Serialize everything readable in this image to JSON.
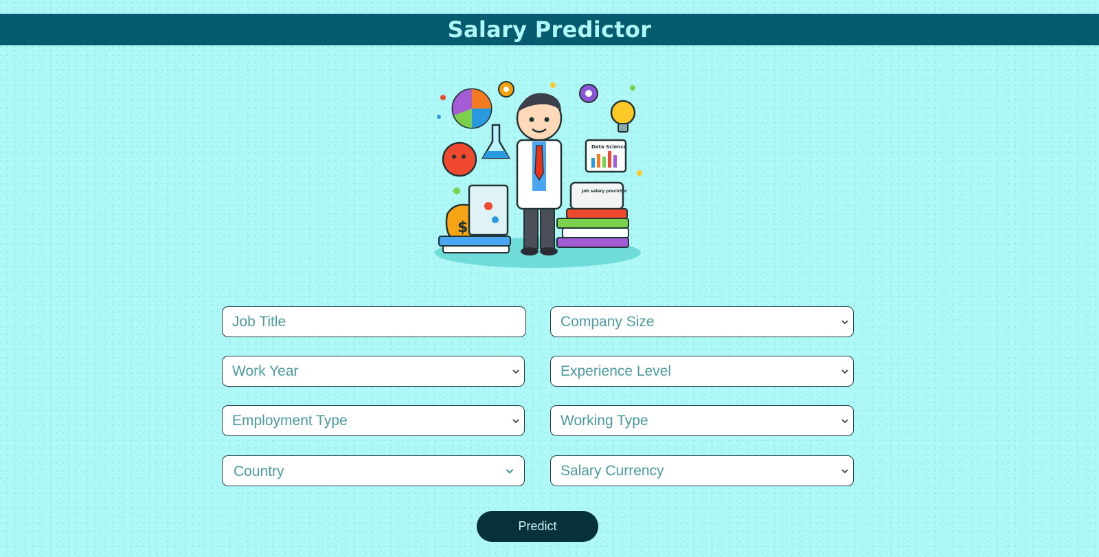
{
  "header": {
    "title": "Salary Predictor"
  },
  "illustration": {
    "screen_text": "Data Science",
    "box_text": "Job salary precictor"
  },
  "form": {
    "job_title_placeholder": "Job Title",
    "company_size": "Company Size",
    "work_year": "Work Year",
    "experience_level": "Experience Level",
    "employment_type": "Employment Type",
    "working_type": "Working Type",
    "country": "Country",
    "salary_currency": "Salary Currency"
  },
  "actions": {
    "predict_label": "Predict"
  },
  "colors": {
    "background": "#aef9f8",
    "header_bg": "#075b6e",
    "header_text": "#aef9f8",
    "button_bg": "#07323c",
    "field_text": "#4a9aa0"
  }
}
